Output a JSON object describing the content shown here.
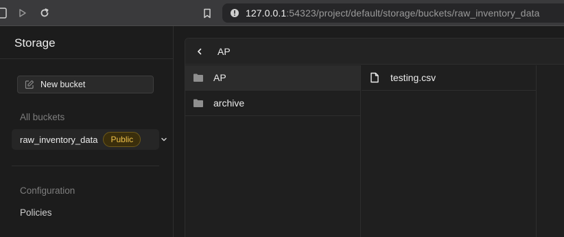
{
  "browser": {
    "url_host": "127.0.0.1",
    "url_rest": ":54323/project/default/storage/buckets/raw_inventory_data"
  },
  "sidebar": {
    "title": "Storage",
    "new_bucket_label": "New bucket",
    "all_buckets_label": "All buckets",
    "buckets": [
      {
        "name": "raw_inventory_data",
        "badge": "Public"
      }
    ],
    "configuration_label": "Configuration",
    "policies_label": "Policies"
  },
  "explorer": {
    "path": "AP",
    "column1": [
      {
        "label": "AP",
        "type": "folder",
        "selected": true
      },
      {
        "label": "archive",
        "type": "folder",
        "selected": false
      }
    ],
    "column2": [
      {
        "label": "testing.csv",
        "type": "file"
      }
    ]
  },
  "colors": {
    "badge_text": "#f0c24a",
    "badge_bg": "#3a2e0c",
    "background": "#1c1c1c"
  }
}
